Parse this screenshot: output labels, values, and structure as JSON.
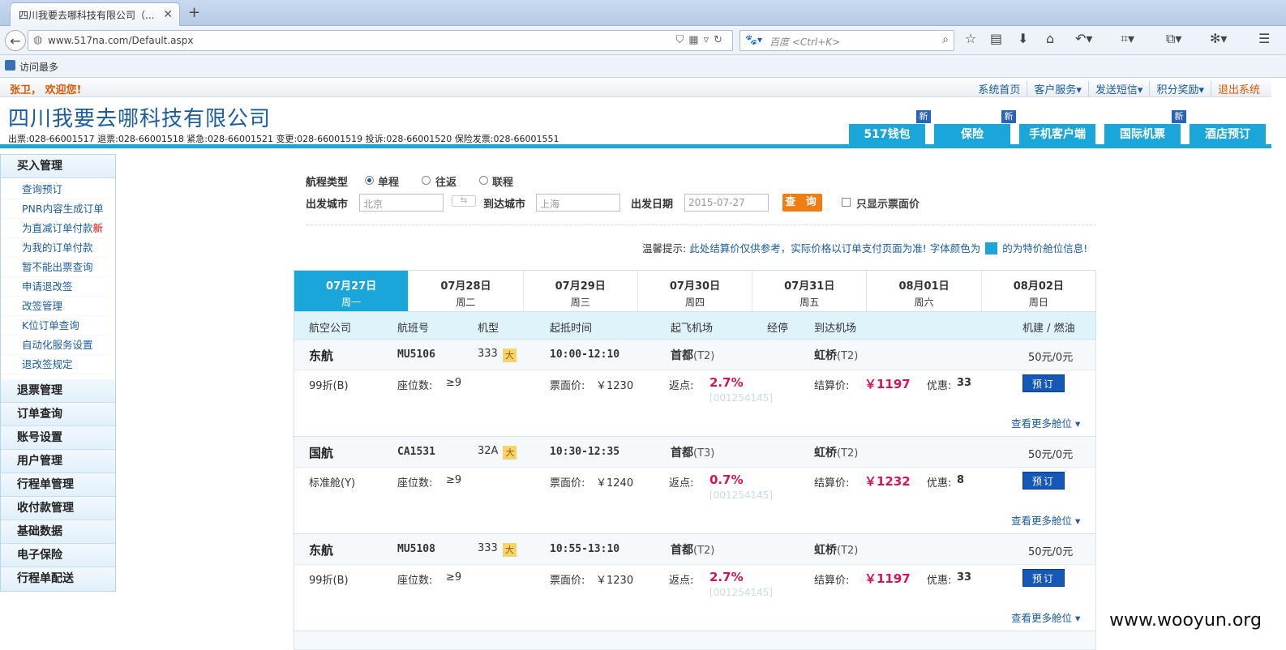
{
  "browser": {
    "tab_title": "四川我要去哪科技有限公司（...",
    "url": "www.517na.com/Default.aspx",
    "search_engine": "百度",
    "search_placeholder": "百度 <Ctrl+K>",
    "bookmark": "访问最多"
  },
  "site": {
    "welcome": "张卫， 欢迎您!",
    "top_links": [
      "系统首页",
      "客户服务▾",
      "发送短信▾",
      "积分奖励▾",
      "退出系统"
    ],
    "company": "四川我要去哪科技有限公司",
    "phones": "出票:028-66001517 退票:028-66001518 紧急:028-66001521 变更:028-66001519 投诉:028-66001520 保险发票:028-66001551",
    "nav_tabs": [
      {
        "label": "517钱包",
        "new": "新"
      },
      {
        "label": "保险",
        "new": "新"
      },
      {
        "label": "手机客户端",
        "new": ""
      },
      {
        "label": "国际机票",
        "new": "新"
      },
      {
        "label": "酒店预订",
        "new": ""
      }
    ]
  },
  "sidebar": {
    "sections": [
      {
        "title": "买入管理",
        "items": [
          "查询预订",
          "PNR内容生成订单",
          "为直减订单付款",
          "为我的订单付款",
          "暂不能出票查询",
          "申请退改签",
          "改签管理",
          "K位订单查询",
          "自动化服务设置",
          "退改签规定"
        ]
      },
      {
        "title": "退票管理"
      },
      {
        "title": "订单查询"
      },
      {
        "title": "账号设置"
      },
      {
        "title": "用户管理"
      },
      {
        "title": "行程单管理"
      },
      {
        "title": "收付款管理"
      },
      {
        "title": "基础数据"
      },
      {
        "title": "电子保险"
      },
      {
        "title": "行程单配送"
      }
    ],
    "new_badge": "新"
  },
  "search": {
    "trip_type_label": "航程类型",
    "trip_types": [
      "单程",
      "往返",
      "联程"
    ],
    "selected_trip": "单程",
    "from_label": "出发城市",
    "from_value": "北京",
    "to_label": "到达城市",
    "to_value": "上海",
    "date_label": "出发日期",
    "date_value": "2015-07-27",
    "query_button": "查 询",
    "only_face_label": "只显示票面价",
    "swap_label": "⇆"
  },
  "tip": {
    "prefix": "温馨提示:",
    "text": "此处结算价仅供参考，实际价格以订单支付页面为准! 字体颜色为",
    "suffix": "的为特价舱位信息!",
    "swatch_color": "#1aa6d8"
  },
  "dates": [
    {
      "date": "07月27日",
      "weekday": "周一",
      "active": true
    },
    {
      "date": "07月28日",
      "weekday": "周二"
    },
    {
      "date": "07月29日",
      "weekday": "周三"
    },
    {
      "date": "07月30日",
      "weekday": "周四"
    },
    {
      "date": "07月31日",
      "weekday": "周五"
    },
    {
      "date": "08月01日",
      "weekday": "周六"
    },
    {
      "date": "08月02日",
      "weekday": "周日"
    }
  ],
  "table": {
    "headers": [
      "航空公司",
      "航班号",
      "机型",
      "起抵时间",
      "起飞机场",
      "经停",
      "到达机场",
      "机建 / 燃油"
    ],
    "flights": [
      {
        "airline": "东航",
        "flight_no": "MU5106",
        "aircraft": "333",
        "size": "大",
        "time": "10:00-12:10",
        "dep": "首都",
        "dep_term": "(T2)",
        "arr": "虹桥",
        "arr_term": "(T2)",
        "tax": "50元/0元",
        "cabin": "99折(B)",
        "seats_label": "座位数:",
        "seats": "≥9",
        "face_label": "票面价:",
        "face": "￥1230",
        "rebate_label": "返点:",
        "rebate": "2.7%",
        "code": "[001254145]",
        "settle_label": "结算价:",
        "settle": "￥1197",
        "disc_label": "优惠:",
        "disc": "33",
        "book": "预订",
        "more": "查看更多舱位 ▾"
      },
      {
        "airline": "国航",
        "flight_no": "CA1531",
        "aircraft": "32A",
        "size": "大",
        "time": "10:30-12:35",
        "dep": "首都",
        "dep_term": "(T3)",
        "arr": "虹桥",
        "arr_term": "(T2)",
        "tax": "50元/0元",
        "cabin": "标准舱(Y)",
        "seats_label": "座位数:",
        "seats": "≥9",
        "face_label": "票面价:",
        "face": "￥1240",
        "rebate_label": "返点:",
        "rebate": "0.7%",
        "code": "[001254145]",
        "settle_label": "结算价:",
        "settle": "￥1232",
        "disc_label": "优惠:",
        "disc": "8",
        "book": "预订",
        "more": "查看更多舱位 ▾"
      },
      {
        "airline": "东航",
        "flight_no": "MU5108",
        "aircraft": "333",
        "size": "大",
        "time": "10:55-13:10",
        "dep": "首都",
        "dep_term": "(T2)",
        "arr": "虹桥",
        "arr_term": "(T2)",
        "tax": "50元/0元",
        "cabin": "99折(B)",
        "seats_label": "座位数:",
        "seats": "≥9",
        "face_label": "票面价:",
        "face": "￥1230",
        "rebate_label": "返点:",
        "rebate": "2.7%",
        "code": "[001254145]",
        "settle_label": "结算价:",
        "settle": "￥1197",
        "disc_label": "优惠:",
        "disc": "33",
        "book": "预订",
        "more": "查看更多舱位 ▾"
      }
    ]
  },
  "watermark": "www.wooyun.org"
}
